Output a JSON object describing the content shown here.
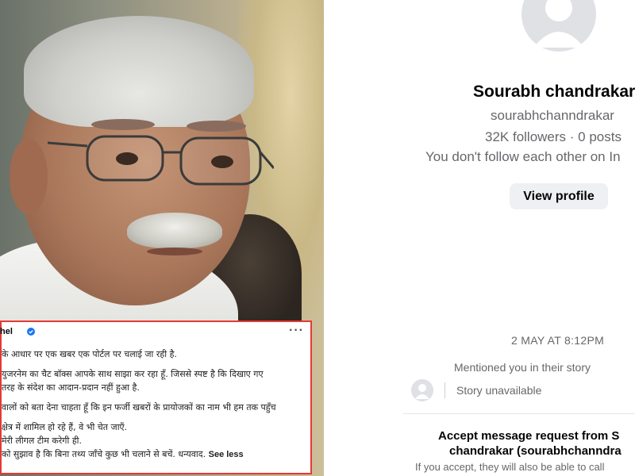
{
  "post": {
    "author": "hel",
    "more_label": "···",
    "lines": [
      "के आधार पर एक खबर एक पोर्टल पर चलाई जा रही है.",
      "",
      "युजरनेम का चैट बॉक्स आपके साथ साझा कर रहा हूँ. जिससे स्पष्ट है कि दिखाए गए",
      "तरह के संदेश का आदान-प्रदान नहीं हुआ है.",
      "",
      "वालों को बता देना चाहता हूँ कि इन फर्जी खबरों के प्रायोजकों का नाम भी हम तक पहुँच",
      "",
      "क्षेत्र में शामिल हो रहे हैं, वे भी चेत जाएँ.",
      "मेरी लीगल टीम करेगी ही.",
      "को सुझाव है कि बिना तथ्य जाँचे कुछ भी चलाने से बचें. धन्यवाद."
    ],
    "see_less": "See less"
  },
  "profile": {
    "name": "Sourabh chandrakar",
    "username": "sourabhchanndrakar",
    "stats": "32K followers · 0 posts",
    "follow_status": "You don't follow each other on In",
    "view_profile_label": "View profile"
  },
  "thread": {
    "timestamp": "2 MAY AT 8:12PM",
    "mention": "Mentioned you in their story",
    "story_status": "Story unavailable",
    "request_title": "Accept message request from S",
    "request_name": "chandrakar (sourabhchanndra",
    "request_note": "If you accept, they will also be able to call"
  },
  "colors": {
    "card_border": "#e53935",
    "verified": "#1877f2",
    "button_bg": "#eef0f3",
    "muted_text": "#65676b"
  },
  "icons": [
    "verified-badge-icon",
    "more-options-icon",
    "default-avatar-icon"
  ]
}
